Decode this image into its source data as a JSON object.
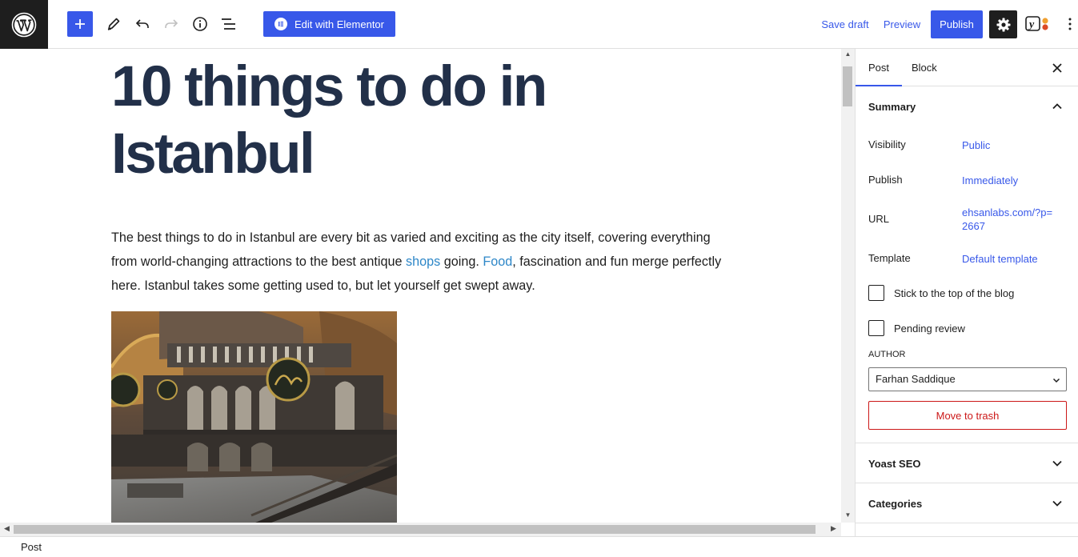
{
  "toolbar": {
    "elementor_label": "Edit with Elementor",
    "save_draft_label": "Save draft",
    "preview_label": "Preview",
    "publish_label": "Publish",
    "yoast_letter": "y"
  },
  "post": {
    "title": "10 things to do in Istanbul",
    "paragraph_before_shops": "The best things to do in Istanbul are every bit as varied and exciting as the city itself, covering everything from world-changing attractions to the best antique ",
    "link_shops": "shops",
    "text_going": " going. ",
    "link_food": "Food",
    "paragraph_after_food": ", fascination and fun merge perfectly here. Istanbul takes some getting used to, but let yourself get swept away."
  },
  "footer": {
    "breadcrumb": "Post"
  },
  "sidebar": {
    "tabs": [
      {
        "label": "Post"
      },
      {
        "label": "Block"
      }
    ],
    "summary": {
      "title": "Summary",
      "visibility_label": "Visibility",
      "visibility_value": "Public",
      "publish_label": "Publish",
      "publish_value": "Immediately",
      "url_label": "URL",
      "url_value": "ehsanlabs.com/?p=2667",
      "template_label": "Template",
      "template_value": "Default template",
      "sticky_label": "Stick to the top of the blog",
      "sticky_checked": false,
      "pending_label": "Pending review",
      "pending_checked": false,
      "author_label": "AUTHOR",
      "author_value": "Farhan Saddique",
      "trash_label": "Move to trash"
    },
    "panels": [
      {
        "title": "Yoast SEO"
      },
      {
        "title": "Categories"
      }
    ]
  },
  "colors": {
    "accent": "#3858e9",
    "title": "#223049",
    "link": "#2e87c8",
    "danger": "#cc1818",
    "dark": "#1e1e1e"
  }
}
